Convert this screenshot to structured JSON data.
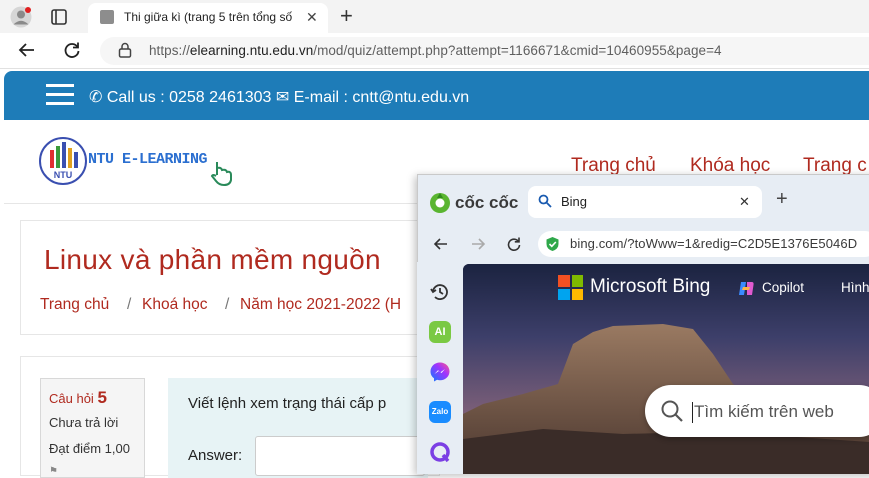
{
  "edge": {
    "tab_title": "Thi giữa kì (trang 5 trên tổng số",
    "url_prefix": "https://",
    "url_host": "elearning.ntu.edu.vn",
    "url_path": "/mod/quiz/attempt.php?attempt=1166671&cmid=10460955&page=4"
  },
  "site": {
    "topbar_call": "Call us : 0258 2461303",
    "topbar_email": "E-mail : cntt@ntu.edu.vn",
    "brand": "NTU E-LEARNING",
    "nav": [
      "Trang chủ",
      "Khóa học",
      "Trang c"
    ],
    "page_title": "Linux và phần mềm nguồn",
    "breadcrumb": [
      "Trang chủ",
      "Khoá học",
      "Năm học 2021-2022 (H"
    ],
    "question": {
      "label": "Câu hỏi",
      "number": "5",
      "status": "Chưa trả lời",
      "points": "Đạt điểm 1,00",
      "text": "Viết lệnh xem trạng thái cấp p",
      "answer_label": "Answer:"
    }
  },
  "coccoc": {
    "brand": "cốc cốc",
    "tab_title": "Bing",
    "url": "bing.com/?toWww=1&redig=C2D5E1376E5046D",
    "bing_logo": "Microsoft Bing",
    "copilot": "Copilot",
    "hinh": "Hình",
    "search_placeholder": "Tìm kiếm trên web",
    "sidebar_ai": "AI",
    "sidebar_zalo": "Zalo"
  },
  "colors": {
    "topbar": "#1e7cb8",
    "link_red": "#b02a1f",
    "coccoc_green": "#5ab530"
  }
}
